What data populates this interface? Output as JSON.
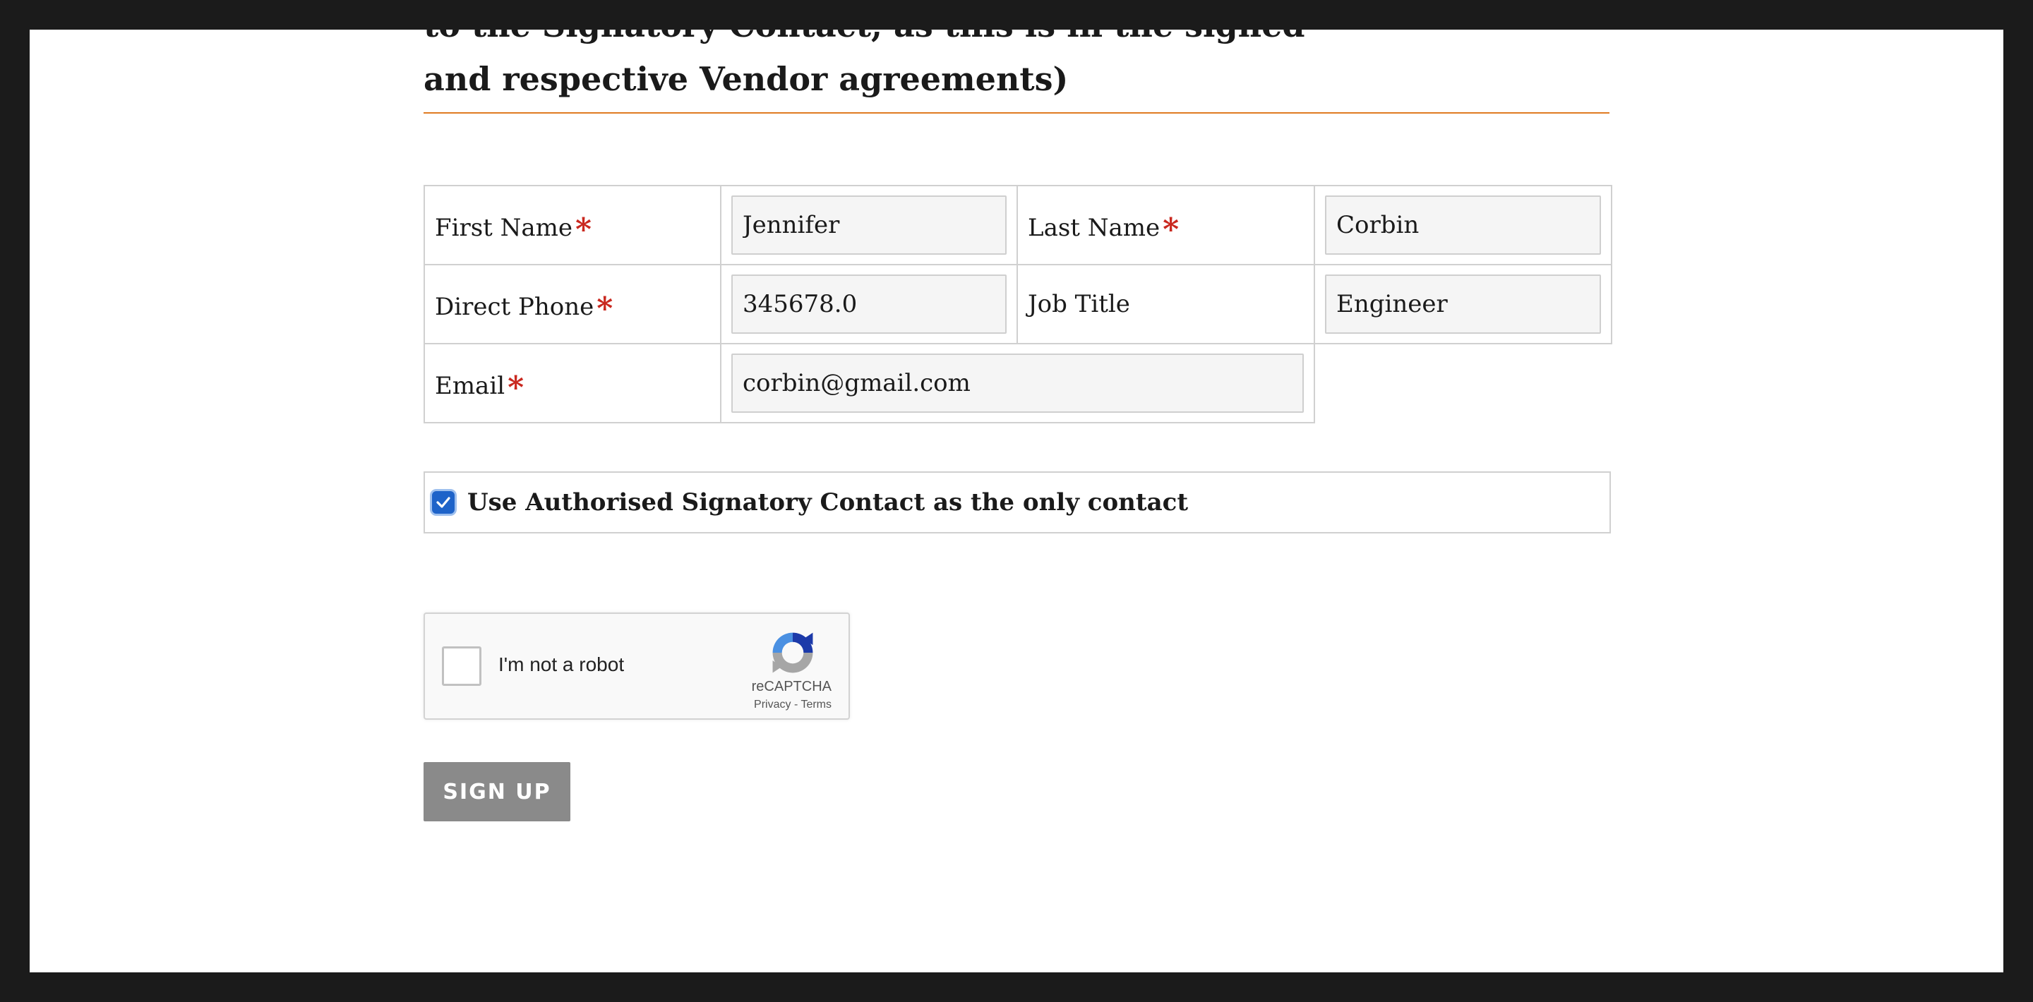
{
  "heading": {
    "line1": "to the Signatory Contact, as this is in the signed",
    "line2": "and respective Vendor agreements)"
  },
  "form": {
    "first_name": {
      "label": "First Name",
      "required_mark": "*",
      "value": "Jennifer"
    },
    "last_name": {
      "label": "Last Name",
      "required_mark": "*",
      "value": "Corbin"
    },
    "direct_phone": {
      "label": "Direct Phone",
      "required_mark": "*",
      "value": "345678.0"
    },
    "job_title": {
      "label": "Job Title",
      "value": "Engineer"
    },
    "email": {
      "label": "Email",
      "required_mark": "*",
      "value": "corbin@gmail.com"
    }
  },
  "signatory_checkbox": {
    "label": "Use Authorised Signatory Contact as the only contact",
    "checked": true
  },
  "recaptcha": {
    "label": "I'm not a robot",
    "brand": "reCAPTCHA",
    "privacy": "Privacy",
    "separator": "-",
    "terms": "Terms"
  },
  "signup_button": {
    "label": "SIGN UP"
  },
  "colors": {
    "accent_rule": "#e07b22",
    "required": "#c9281f",
    "checkbox": "#1e63c9",
    "button_bg": "#8a8a8a"
  }
}
